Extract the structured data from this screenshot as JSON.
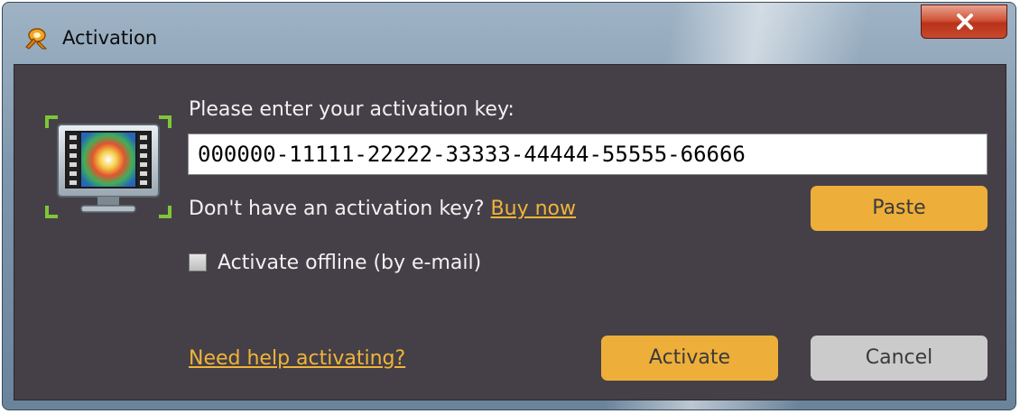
{
  "window": {
    "title": "Activation",
    "icon": "app-logo-icon",
    "close_icon": "close-icon"
  },
  "dialog": {
    "prompt": "Please enter your activation key:",
    "key_value": "000000-11111-22222-33333-44444-55555-66666",
    "no_key_text": "Don't have an activation key?",
    "buy_link": "Buy now",
    "paste_label": "Paste",
    "offline_label": "Activate offline (by e-mail)",
    "offline_checked": false,
    "help_link": "Need help activating?",
    "activate_label": "Activate",
    "cancel_label": "Cancel",
    "illustration_icon": "monitor-icon"
  },
  "colors": {
    "accent": "#eeae3a",
    "link": "#f0b43a",
    "panel_bg": "#454047",
    "cancel_bg": "#cccbcc"
  }
}
